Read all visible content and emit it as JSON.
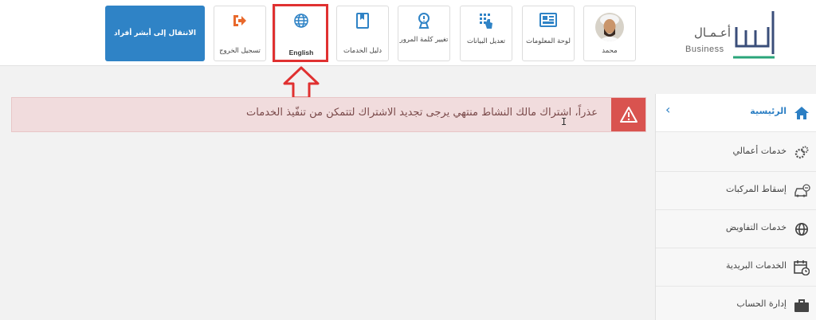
{
  "header": {
    "logo": {
      "arabic": "أعـمـال",
      "english": "Business"
    },
    "user": {
      "name": "محمد"
    },
    "tiles": [
      {
        "id": "dashboard",
        "label": "لوحة المعلومات",
        "icon": "dashboard-icon"
      },
      {
        "id": "edit-data",
        "label": "تعديل البيانات",
        "icon": "touch-grid-icon"
      },
      {
        "id": "change-password",
        "label": "تغيير كلمة المرور",
        "icon": "key-lock-icon"
      },
      {
        "id": "services-guide",
        "label": "دليل الخدمات",
        "icon": "book-icon"
      },
      {
        "id": "language",
        "label": "English",
        "icon": "globe-icon"
      },
      {
        "id": "logout",
        "label": "تسجيل الخروج",
        "icon": "sign-out-icon"
      }
    ],
    "absher_button": "الانتقال إلى أبشر أفراد"
  },
  "colors": {
    "brand_blue": "#2f83c6",
    "alert_red": "#d9534f",
    "highlight_red": "#e03131",
    "alert_bg": "#f1dcdd"
  },
  "alert": {
    "message": "عذراً، اشتراك مالك النشاط منتهي يرجى تجديد الاشتراك لتتمكن من تنفّيذ الخدمات",
    "icon": "warning-triangle-icon"
  },
  "sidebar": {
    "items": [
      {
        "label": "الرئيسية",
        "icon": "home-icon",
        "active": true
      },
      {
        "label": "خدمات أعمالي",
        "icon": "gears-icon"
      },
      {
        "label": "إسقاط المركبات",
        "icon": "car-remove-icon"
      },
      {
        "label": "خدمات التفاويض",
        "icon": "globe-icon"
      },
      {
        "label": "الخدمات البريدية",
        "icon": "calendar-clock-icon"
      },
      {
        "label": "إدارة الحساب",
        "icon": "briefcase-icon"
      }
    ]
  }
}
